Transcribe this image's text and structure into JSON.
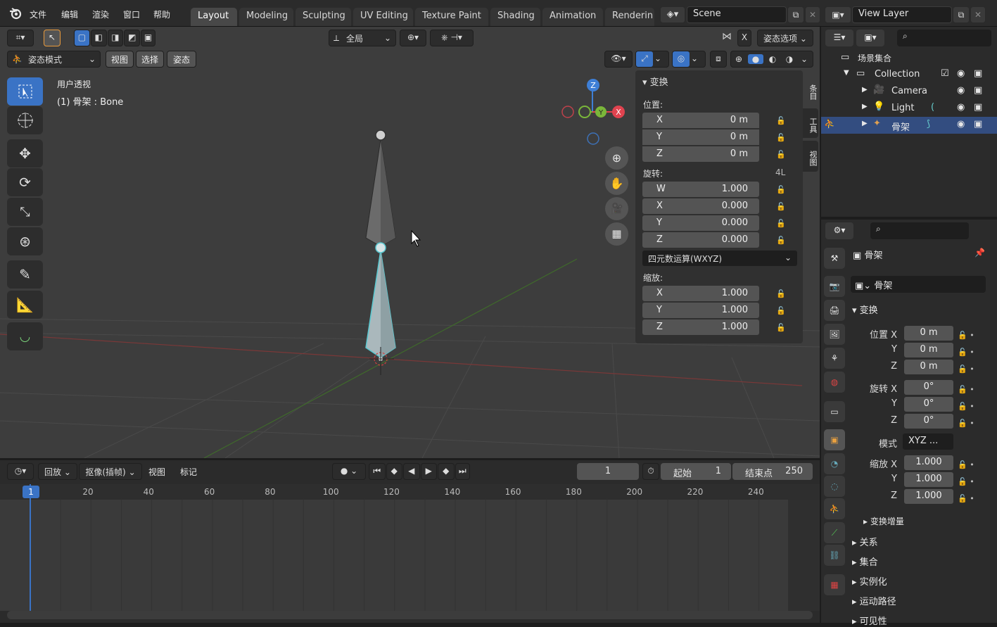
{
  "topbar": {
    "menu": [
      "文件",
      "编辑",
      "渲染",
      "窗口",
      "帮助"
    ],
    "workspaces": [
      "Layout",
      "Modeling",
      "Sculpting",
      "UV Editing",
      "Texture Paint",
      "Shading",
      "Animation",
      "Renderin"
    ],
    "scene": "Scene",
    "view_layer": "View Layer"
  },
  "viewport_header": {
    "transform_orientation": "全局",
    "pose_options": "姿态选项",
    "x_mirror": "X",
    "mode": "姿态模式",
    "menus": [
      "视图",
      "选择",
      "姿态"
    ]
  },
  "viewport": {
    "view_name": "用户透视",
    "active_object": "(1) 骨架 : Bone",
    "gizmo_axes": {
      "x": "X",
      "y": "Y",
      "z": "Z"
    }
  },
  "npanel": {
    "title": "变换",
    "location_label": "位置:",
    "location": [
      {
        "axis": "X",
        "value": "0 m"
      },
      {
        "axis": "Y",
        "value": "0 m"
      },
      {
        "axis": "Z",
        "value": "0 m"
      }
    ],
    "rotation_label": "旋转:",
    "rotation_mode_badge": "4L",
    "rotation": [
      {
        "axis": "W",
        "value": "1.000"
      },
      {
        "axis": "X",
        "value": "0.000"
      },
      {
        "axis": "Y",
        "value": "0.000"
      },
      {
        "axis": "Z",
        "value": "0.000"
      }
    ],
    "rotation_mode": "四元数运算(WXYZ)",
    "scale_label": "缩放:",
    "scale": [
      {
        "axis": "X",
        "value": "1.000"
      },
      {
        "axis": "Y",
        "value": "1.000"
      },
      {
        "axis": "Z",
        "value": "1.000"
      }
    ],
    "side_tabs": [
      "条目",
      "工具",
      "视图"
    ]
  },
  "outliner": {
    "root": "场景集合",
    "items": [
      {
        "name": "Collection"
      },
      {
        "name": "Camera"
      },
      {
        "name": "Light"
      },
      {
        "name": "骨架"
      }
    ]
  },
  "properties": {
    "object_name": "骨架",
    "object_field": "骨架",
    "transform_title": "变换",
    "location_label": "位置 X",
    "location": [
      "0 m",
      "0 m",
      "0 m"
    ],
    "rotation_label": "旋转 X",
    "rotation": [
      "0°",
      "0°",
      "0°"
    ],
    "mode_label": "模式",
    "mode_value": "XYZ ...",
    "scale_label": "缩放 X",
    "scale": [
      "1.000",
      "1.000",
      "1.000"
    ],
    "axis_y": "Y",
    "axis_z": "Z",
    "delta_transform": "变换增量",
    "sections": [
      "关系",
      "集合",
      "实例化",
      "运动路径",
      "可见性"
    ]
  },
  "timeline": {
    "playback": "回放",
    "keying": "抠像(插帧)",
    "view": "视图",
    "marker": "标记",
    "current_frame": "1",
    "start_label": "起始",
    "start": "1",
    "end_label": "结束点",
    "end": "250",
    "ruler": [
      "20",
      "40",
      "60",
      "80",
      "100",
      "120",
      "140",
      "160",
      "180",
      "200",
      "220",
      "240"
    ],
    "playhead_label": "1"
  },
  "colors": {
    "accent": "#3a73c5",
    "bone_selected": "#59c8d0",
    "axis_x": "#e0434f",
    "axis_y": "#7ab63a",
    "axis_z": "#3e7fd6"
  }
}
